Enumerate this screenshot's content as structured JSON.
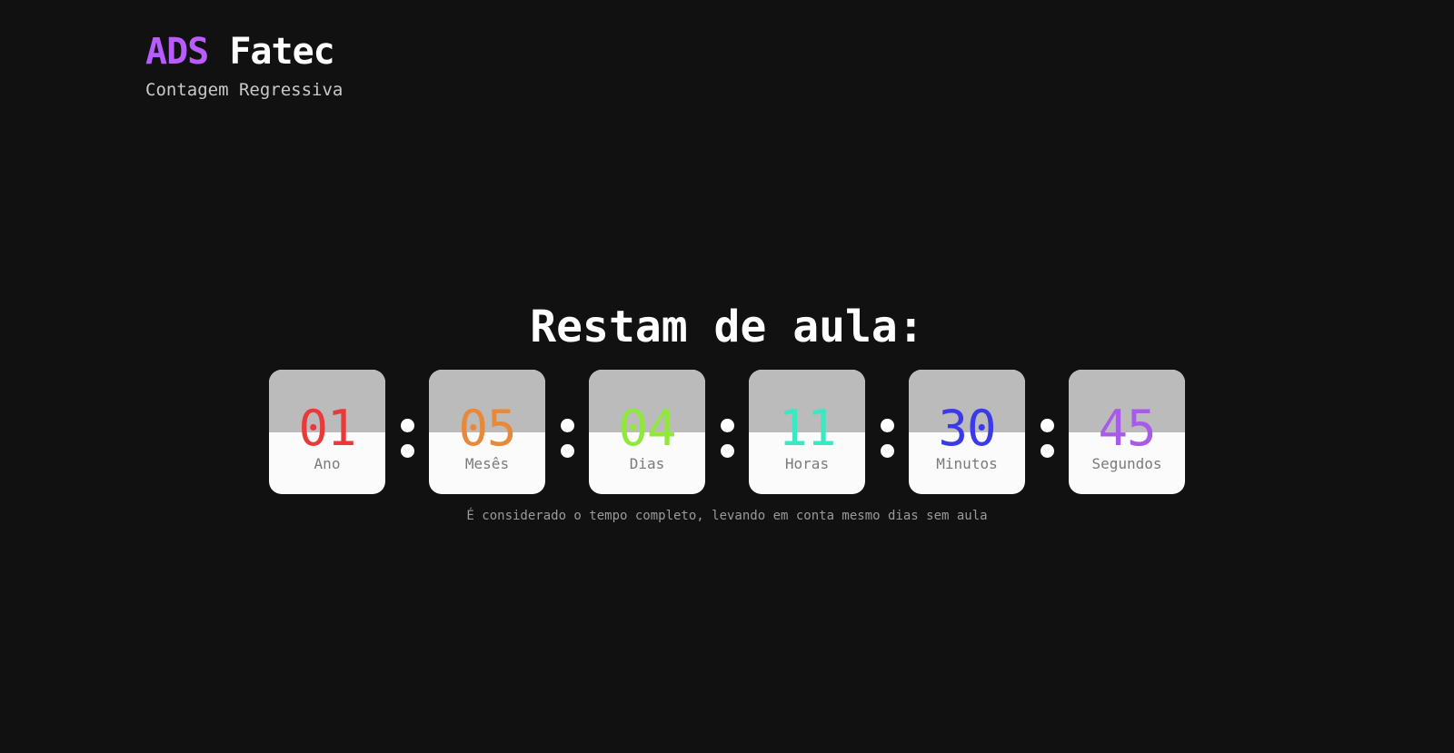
{
  "header": {
    "brand_accent": "ADS",
    "brand_main": "Fatec",
    "subtitle": "Contagem Regressiva"
  },
  "main": {
    "headline": "Restam de aula:",
    "note": "É considerado o tempo completo, levando em conta mesmo dias sem aula",
    "units": [
      {
        "value": "01",
        "label": "Ano",
        "color": "#e83a3a"
      },
      {
        "value": "05",
        "label": "Mesês",
        "color": "#e8893a"
      },
      {
        "value": "04",
        "label": "Dias",
        "color": "#8fe83a"
      },
      {
        "value": "11",
        "label": "Horas",
        "color": "#3ae8c3"
      },
      {
        "value": "30",
        "label": "Minutos",
        "color": "#3a3ae8"
      },
      {
        "value": "45",
        "label": "Segundos",
        "color": "#a85ae8"
      }
    ]
  },
  "colors": {
    "background": "#111111",
    "accent": "#b85cff",
    "card_top": "#bbbbbb",
    "card_bottom": "#fbfbfb"
  }
}
